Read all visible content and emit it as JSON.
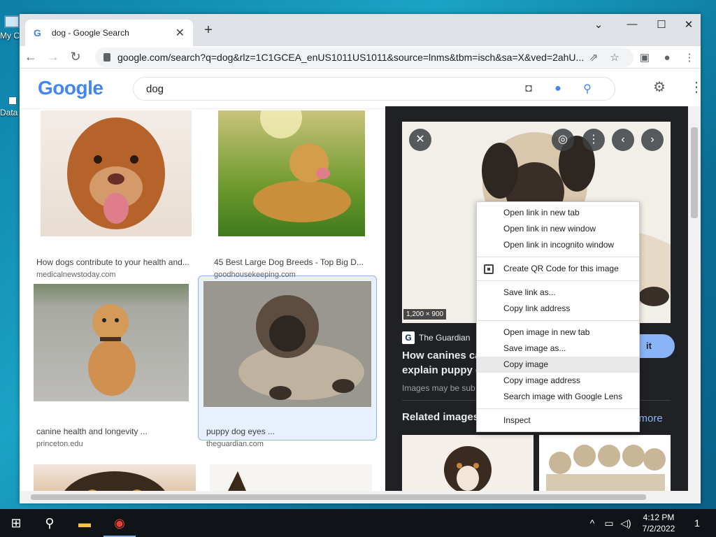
{
  "desktop": {
    "icons": [
      {
        "label": "My C"
      },
      {
        "label": "Data"
      }
    ]
  },
  "browser": {
    "tab_title": "dog - Google Search",
    "url": "google.com/search?q=dog&rlz=1C1GCEA_enUS1011US1011&source=lnms&tbm=isch&sa=X&ved=2ahU...",
    "window_controls": {
      "minimize": "—",
      "maximize": "☐",
      "close": "✕",
      "tab_menu": "⌄"
    }
  },
  "google": {
    "logo": "Google",
    "query": "dog"
  },
  "results": [
    {
      "caption": "How dogs contribute to your health and...",
      "source": "medicalnewstoday.com"
    },
    {
      "caption": "45 Best Large Dog Breeds - Top Big D...",
      "source": "goodhousekeeping.com"
    },
    {
      "caption": "canine health and longevity ...",
      "source": "princeton.edu"
    },
    {
      "caption": "puppy dog eyes ...",
      "source": "theguardian.com"
    }
  ],
  "panel": {
    "dimensions": "1,200 × 900",
    "source_name": "The Guardian",
    "source_logo": "G",
    "title_line1": "How canines ca",
    "title_line2": "explain puppy d",
    "visit_label": "it",
    "note": "Images may be sub",
    "related_label": "Related images",
    "see_more": "e more"
  },
  "context_menu": {
    "items": [
      "Open link in new tab",
      "Open link in new window",
      "Open link in incognito window",
      "Create QR Code for this image",
      "Save link as...",
      "Copy link address",
      "Open image in new tab",
      "Save image as...",
      "Copy image",
      "Copy image address",
      "Search image with Google Lens",
      "Inspect"
    ],
    "highlighted_index": 8
  },
  "taskbar": {
    "time": "4:12 PM",
    "date": "7/2/2022",
    "notification_count": "1"
  }
}
